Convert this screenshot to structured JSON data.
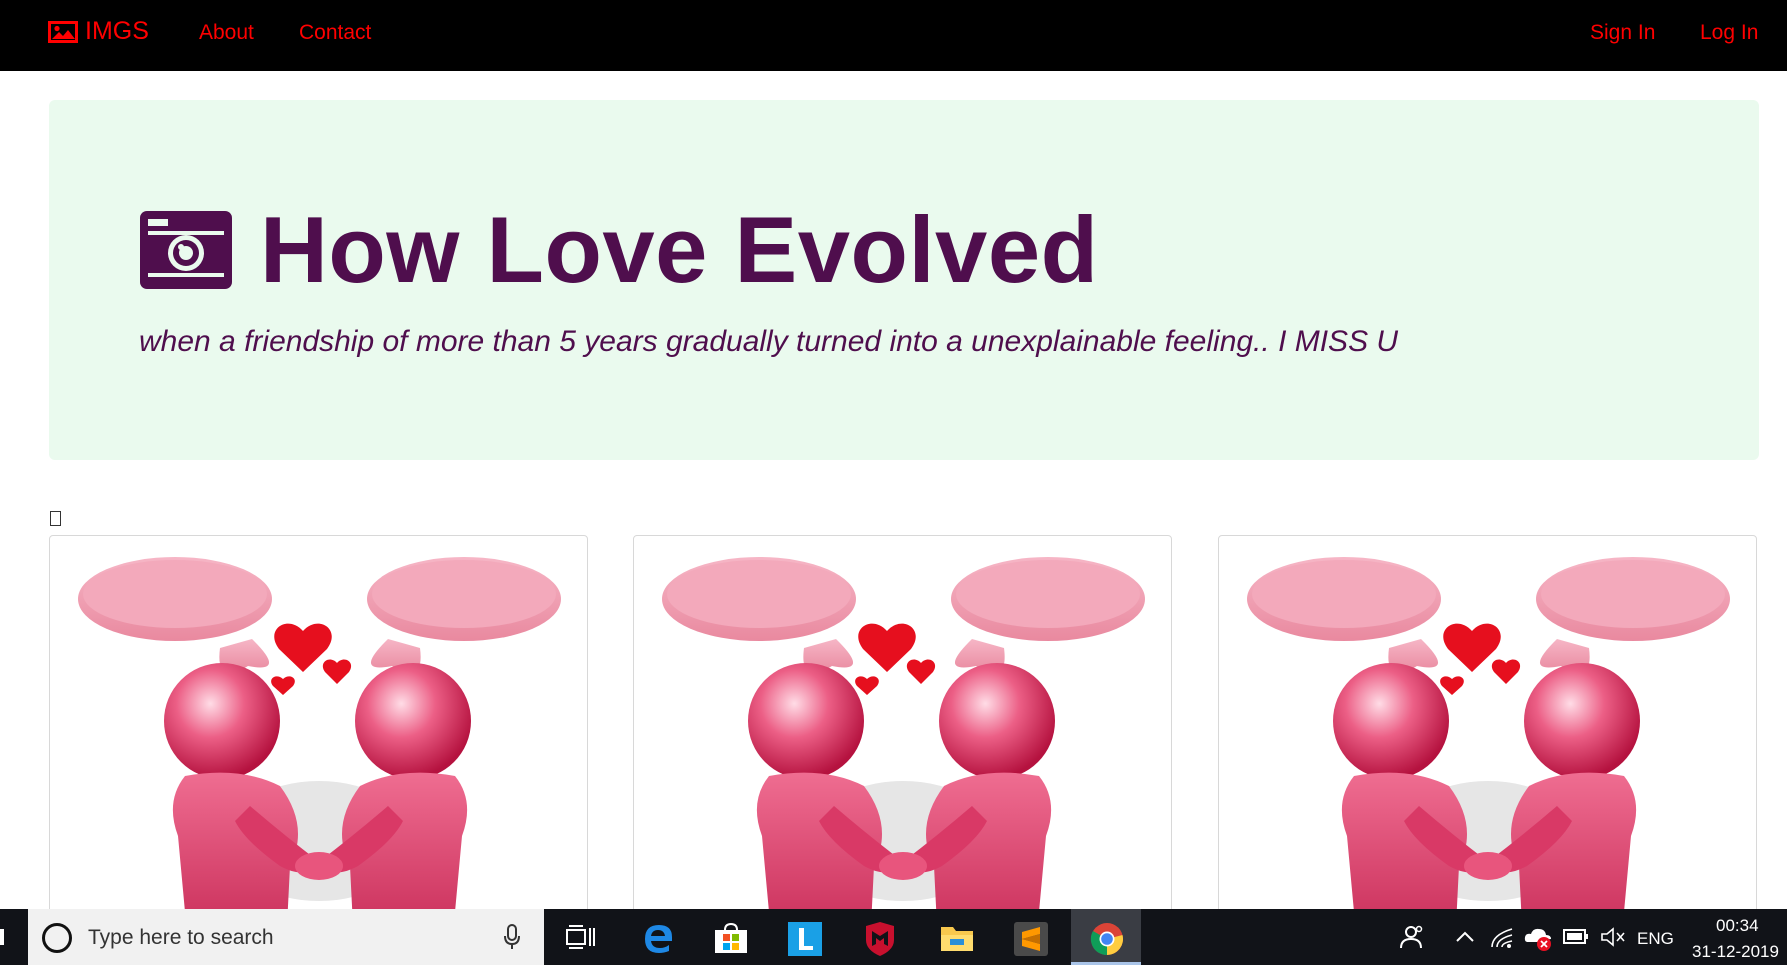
{
  "navbar": {
    "brand": "IMGS",
    "links": [
      "About",
      "Contact"
    ],
    "auth": [
      "Sign In",
      "Log In"
    ]
  },
  "hero": {
    "title": "How Love Evolved",
    "subtitle": "when a friendship of more than 5 years gradually turned into a unexplainable feeling.. I MISS U"
  },
  "gallery": {
    "cards": [
      {
        "image": "love-hearts-figures"
      },
      {
        "image": "love-hearts-figures"
      },
      {
        "image": "love-hearts-figures"
      }
    ]
  },
  "taskbar": {
    "search_placeholder": "Type here to search",
    "language": "ENG",
    "time": "00:34",
    "date": "31-12-2019"
  },
  "colors": {
    "navbar_bg": "#000000",
    "nav_text": "#ff0000",
    "hero_bg": "#eafaee",
    "hero_text": "#4f0e4d"
  }
}
